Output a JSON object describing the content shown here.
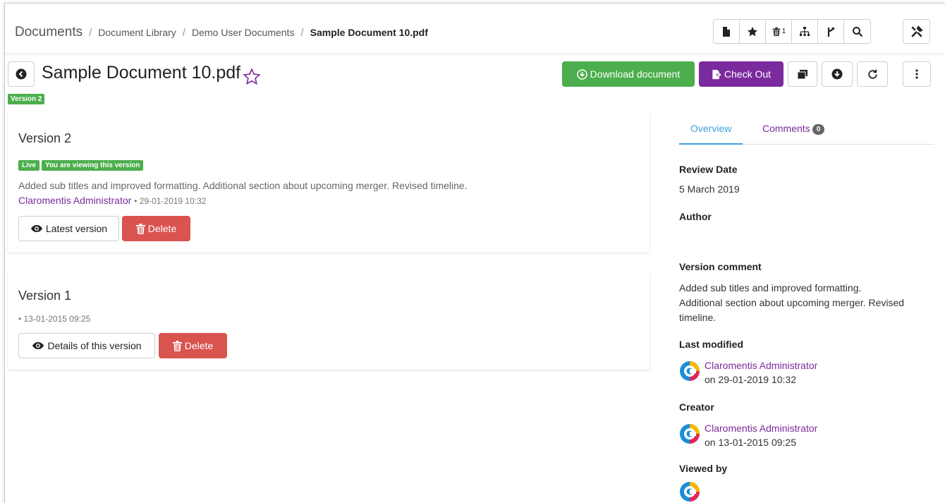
{
  "breadcrumb": {
    "root": "Documents",
    "items": [
      "Document Library",
      "Demo User Documents"
    ],
    "current": "Sample Document 10.pdf",
    "separator": "/"
  },
  "toolbar": {
    "icons": [
      "file-icon",
      "star-icon",
      "trash-count-icon",
      "sitemap-icon",
      "branch-icon",
      "search-icon"
    ],
    "trash_count": "1",
    "tools_icon": "wrench-icon"
  },
  "document": {
    "title": "Sample Document 10.pdf",
    "version_badge": "Version 2",
    "actions": {
      "download": "Download document",
      "checkout": "Check Out"
    }
  },
  "versions": [
    {
      "title": "Version 2",
      "labels": [
        "Live",
        "You are viewing this version"
      ],
      "comment": "Added sub titles and improved formatting. Additional section about upcoming merger. Revised timeline.",
      "author": "Claromentis Administrator",
      "date": "29-01-2019 10:32",
      "view_label": "Latest version",
      "delete_label": "Delete"
    },
    {
      "title": "Version 1",
      "date": "13-01-2015 09:25",
      "view_label": "Details of this version",
      "delete_label": "Delete"
    }
  ],
  "sidebar": {
    "tabs": [
      {
        "label": "Overview",
        "active": true
      },
      {
        "label": "Comments",
        "count": "0",
        "active": false
      }
    ],
    "review_date_label": "Review Date",
    "review_date": "5 March 2019",
    "author_label": "Author",
    "version_comment_label": "Version comment",
    "version_comment": "Added sub titles and improved formatting. Additional section about upcoming merger. Revised timeline.",
    "last_modified_label": "Last modified",
    "last_modified_by": "Claromentis Administrator",
    "last_modified_on": "on 29-01-2019 10:32",
    "creator_label": "Creator",
    "creator_name": "Claromentis Administrator",
    "creator_on": "on 13-01-2015 09:25",
    "viewed_by_label": "Viewed by"
  },
  "colors": {
    "green": "#4cae4c",
    "purple": "#7b2a9e",
    "red": "#d9534f",
    "tab_blue": "#3ba1d9"
  }
}
